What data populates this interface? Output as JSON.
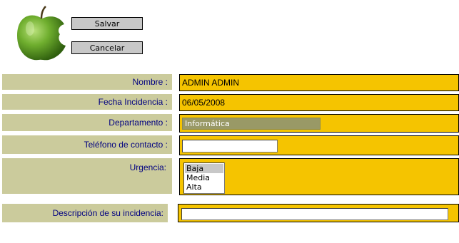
{
  "actions": {
    "save_label": "Salvar",
    "cancel_label": "Cancelar"
  },
  "form": {
    "nombre": {
      "label": "Nombre :",
      "value": "ADMIN ADMIN"
    },
    "fecha": {
      "label": "Fecha Incidencia :",
      "value": "06/05/2008"
    },
    "departamento": {
      "label": "Departamento :",
      "value": "Informática"
    },
    "telefono": {
      "label": "Teléfono de contacto :",
      "value": ""
    },
    "urgencia": {
      "label": "Urgencia:",
      "options": [
        "Baja",
        "Media",
        "Alta"
      ],
      "selected": "Baja"
    },
    "descripcion": {
      "label": "Descripción de su incidencia:",
      "value": ""
    }
  },
  "colors": {
    "label_bg": "#cbcb9c",
    "label_text": "#000080",
    "value_bg": "#f5c400",
    "select_bg": "#999966"
  },
  "icons": {
    "logo": "green-apple-logo"
  }
}
